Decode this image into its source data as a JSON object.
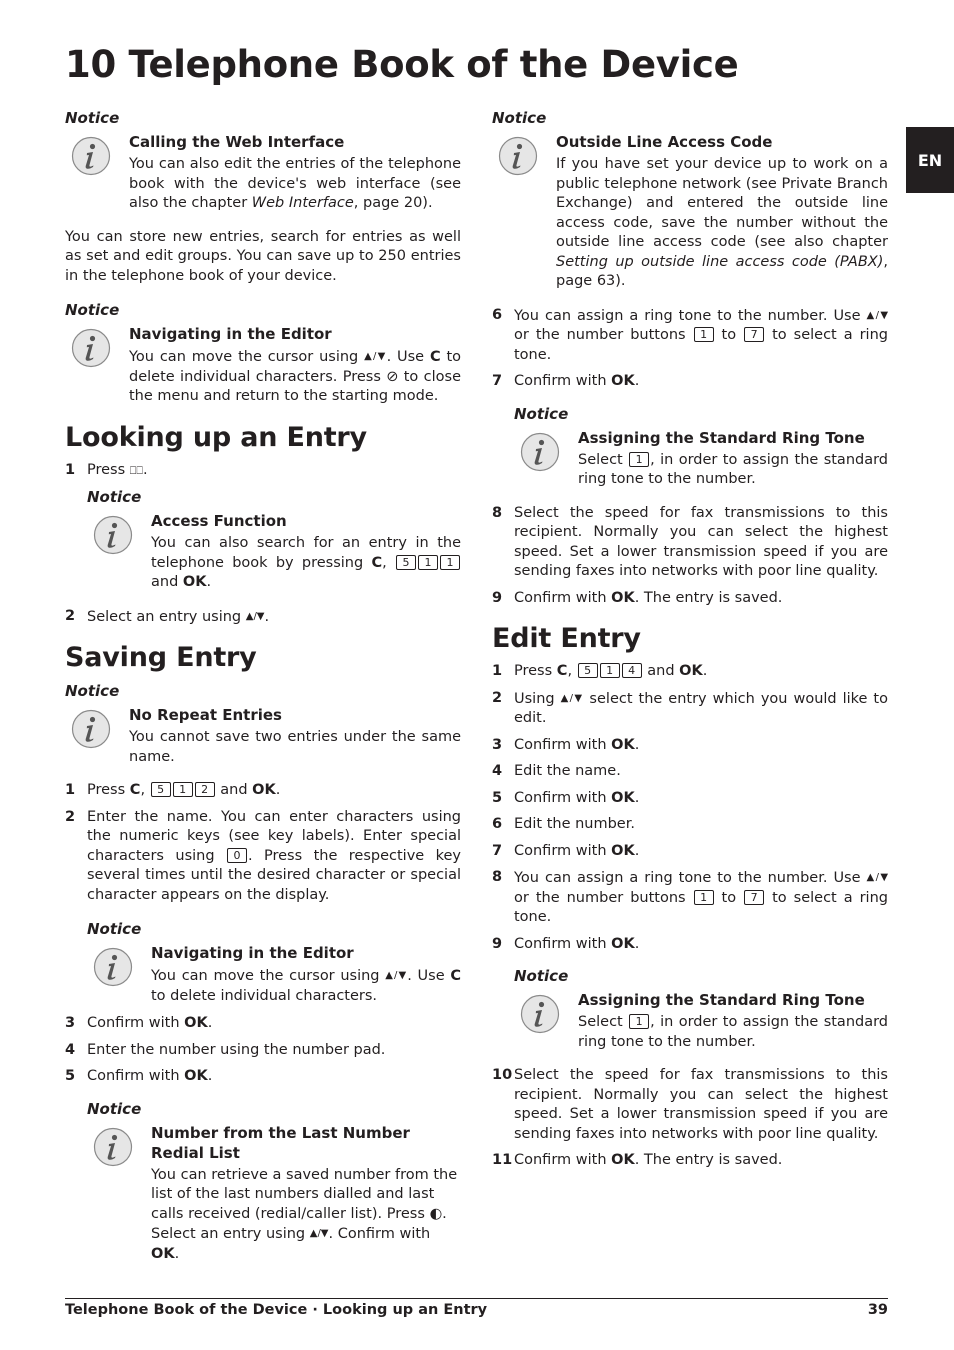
{
  "page": {
    "title": "10 Telephone Book of the Device",
    "language_tab": "EN"
  },
  "left": {
    "notice1": {
      "label": "Notice",
      "title": "Calling the Web Interface",
      "text_before": "You can also edit the entries of the telephone book with the device's web interface (see also the chapter ",
      "link": "Web Interface",
      "text_after": ", page  20)."
    },
    "intro": "You can store new entries, search for entries as well as set and edit groups. You can save up to 250 entries in the telephone book of your device.",
    "notice2": {
      "label": "Notice",
      "title": "Navigating in the Editor",
      "t1": "You can move the cursor using ",
      "t2": ". Use ",
      "c": "C",
      "t3": " to delete individual characters. Press ",
      "t4": " to close the menu and return to the starting mode."
    },
    "looking_up": {
      "heading": "Looking up an Entry",
      "step1": {
        "num": "1",
        "text": "Press ",
        "end": "."
      },
      "notice": {
        "label": "Notice",
        "title": "Access Function",
        "t1": "You can also search for an entry in the telephone book by pressing ",
        "c": "C",
        "keys": [
          "5",
          "1",
          "1"
        ],
        "t2": " and ",
        "ok": "OK",
        "end": "."
      },
      "step2": {
        "num": "2",
        "text": "Select an entry using ",
        "end": "."
      }
    },
    "saving": {
      "heading": "Saving Entry",
      "notice1": {
        "label": "Notice",
        "title": "No Repeat Entries",
        "text": "You cannot save two entries under the same name."
      },
      "step1": {
        "num": "1",
        "t1": "Press ",
        "c": "C",
        "keys": [
          "5",
          "1",
          "2"
        ],
        "t2": " and ",
        "ok": "OK",
        "end": "."
      },
      "step2": {
        "num": "2",
        "t1": "Enter the name. You can enter characters using the numeric keys (see key labels).  Enter special characters using ",
        "key": "0",
        "t2": ". Press the respective key several times until the desired character or special character appears on the display."
      },
      "notice2": {
        "label": "Notice",
        "title": "Navigating in the Editor",
        "t1": "You can move the cursor using ",
        "t2": ". Use ",
        "c": "C",
        "t3": " to delete individual characters."
      },
      "step3": {
        "num": "3",
        "text": "Confirm with ",
        "ok": "OK",
        "end": "."
      },
      "step4": {
        "num": "4",
        "text": "Enter the number using the number pad."
      },
      "step5": {
        "num": "5",
        "text": "Confirm with ",
        "ok": "OK",
        "end": "."
      },
      "notice3": {
        "label": "Notice",
        "title": "Number from the Last Number Redial List",
        "t1": "You can retrieve a saved number from the list of the last numbers dialled and last calls received (redial/caller list). Press ",
        "t2": ". Select an entry using ",
        "t3": ". Confirm with ",
        "ok": "OK",
        "end": "."
      }
    }
  },
  "right": {
    "notice1": {
      "label": "Notice",
      "title": "Outside Line Access Code",
      "text_before": "If you have set your device up to work on a public telephone network (see Private Branch Exchange) and entered the outside line access code, save the number without the outside line access code (see also chapter ",
      "link": "Setting up outside line access code (PABX)",
      "text_after": ", page 63)."
    },
    "step6": {
      "num": "6",
      "t1": "You can assign a ring tone to the number. Use ",
      "t2": " or the number buttons ",
      "key1": "1",
      "t3": " to ",
      "key2": "7",
      "t4": " to select a ring tone."
    },
    "step7": {
      "num": "7",
      "text": "Confirm with ",
      "ok": "OK",
      "end": "."
    },
    "notice2": {
      "label": "Notice",
      "title": "Assigning the Standard Ring Tone",
      "t1": "Select ",
      "key": "1",
      "t2": ", in order to assign the standard ring tone to the number."
    },
    "step8": {
      "num": "8",
      "text": "Select the speed for fax transmissions to this recipient. Normally you can select the highest speed. Set a lower transmission speed if you are sending faxes into networks with poor line quality."
    },
    "step9": {
      "num": "9",
      "text": "Confirm with ",
      "ok": "OK",
      "end": ". The entry is saved."
    },
    "edit": {
      "heading": "Edit Entry",
      "step1": {
        "num": "1",
        "t1": "Press ",
        "c": "C",
        "keys": [
          "5",
          "1",
          "4"
        ],
        "t2": " and ",
        "ok": "OK",
        "end": "."
      },
      "step2": {
        "num": "2",
        "t1": "Using ",
        "t2": " select the entry which you would like to edit."
      },
      "step3": {
        "num": "3",
        "text": "Confirm with ",
        "ok": "OK",
        "end": "."
      },
      "step4": {
        "num": "4",
        "text": "Edit the name."
      },
      "step5": {
        "num": "5",
        "text": "Confirm with ",
        "ok": "OK",
        "end": "."
      },
      "step6": {
        "num": "6",
        "text": "Edit the number."
      },
      "step7": {
        "num": "7",
        "text": "Confirm with ",
        "ok": "OK",
        "end": "."
      },
      "step8": {
        "num": "8",
        "t1": "You can assign a ring tone to the number. Use ",
        "t2": " or the number buttons ",
        "key1": "1",
        "t3": " to ",
        "key2": "7",
        "t4": " to select a ring tone."
      },
      "step9": {
        "num": "9",
        "text": "Confirm with ",
        "ok": "OK",
        "end": "."
      },
      "notice": {
        "label": "Notice",
        "title": "Assigning the Standard Ring Tone",
        "t1": "Select ",
        "key": "1",
        "t2": ", in order to assign the standard ring tone to the number."
      },
      "step10": {
        "num": "10",
        "text": "Select the speed for fax transmissions to this recipient. Normally you can select the highest speed. Set a lower transmission speed if you are sending faxes into networks with poor line quality."
      },
      "step11": {
        "num": "11",
        "text": "Confirm with ",
        "ok": "OK",
        "end": ". The entry is saved."
      }
    }
  },
  "symbols": {
    "up_down": "▲/▼",
    "book": "⎕⎕",
    "stop": "⊘",
    "redial": "◐"
  },
  "footer": {
    "breadcrumb": "Telephone Book of the Device · Looking up an Entry",
    "page_number": "39"
  }
}
